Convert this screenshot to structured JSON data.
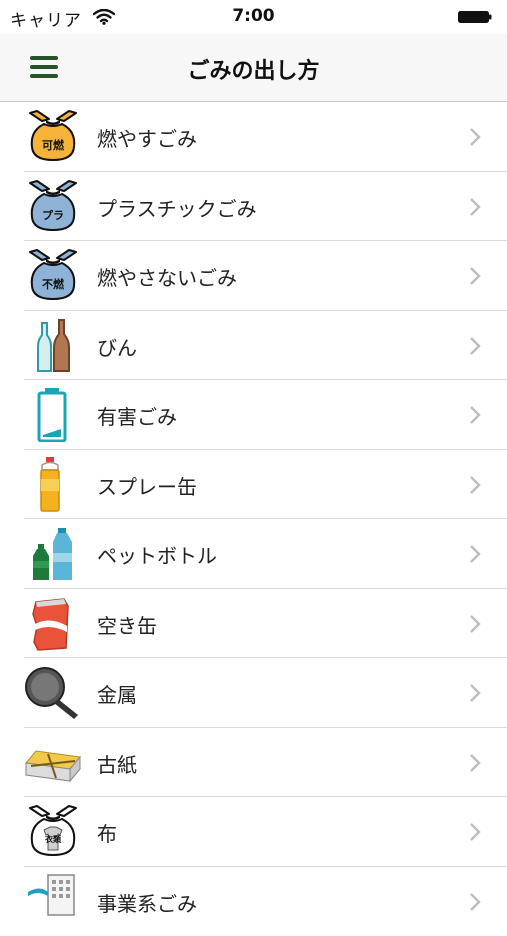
{
  "status_bar": {
    "carrier": "キャリア",
    "time": "7:00"
  },
  "nav": {
    "title": "ごみの出し方",
    "menu_icon": "hamburger-menu-icon",
    "accent_color": "#27532a"
  },
  "items": [
    {
      "label": "燃やすごみ",
      "icon": "burnable-bag-icon",
      "icon_text": "可燃"
    },
    {
      "label": "プラスチックごみ",
      "icon": "plastic-bag-icon",
      "icon_text": "プラ"
    },
    {
      "label": "燃やさないごみ",
      "icon": "nonburnable-bag-icon",
      "icon_text": "不燃"
    },
    {
      "label": "びん",
      "icon": "bottles-icon"
    },
    {
      "label": "有害ごみ",
      "icon": "battery-icon"
    },
    {
      "label": "スプレー缶",
      "icon": "spray-can-icon"
    },
    {
      "label": "ペットボトル",
      "icon": "pet-bottles-icon"
    },
    {
      "label": "空き缶",
      "icon": "empty-can-icon"
    },
    {
      "label": "金属",
      "icon": "frying-pan-icon"
    },
    {
      "label": "古紙",
      "icon": "newspaper-bundle-icon"
    },
    {
      "label": "布",
      "icon": "cloth-bag-icon",
      "icon_text": "衣類"
    },
    {
      "label": "事業系ごみ",
      "icon": "building-icon"
    }
  ]
}
